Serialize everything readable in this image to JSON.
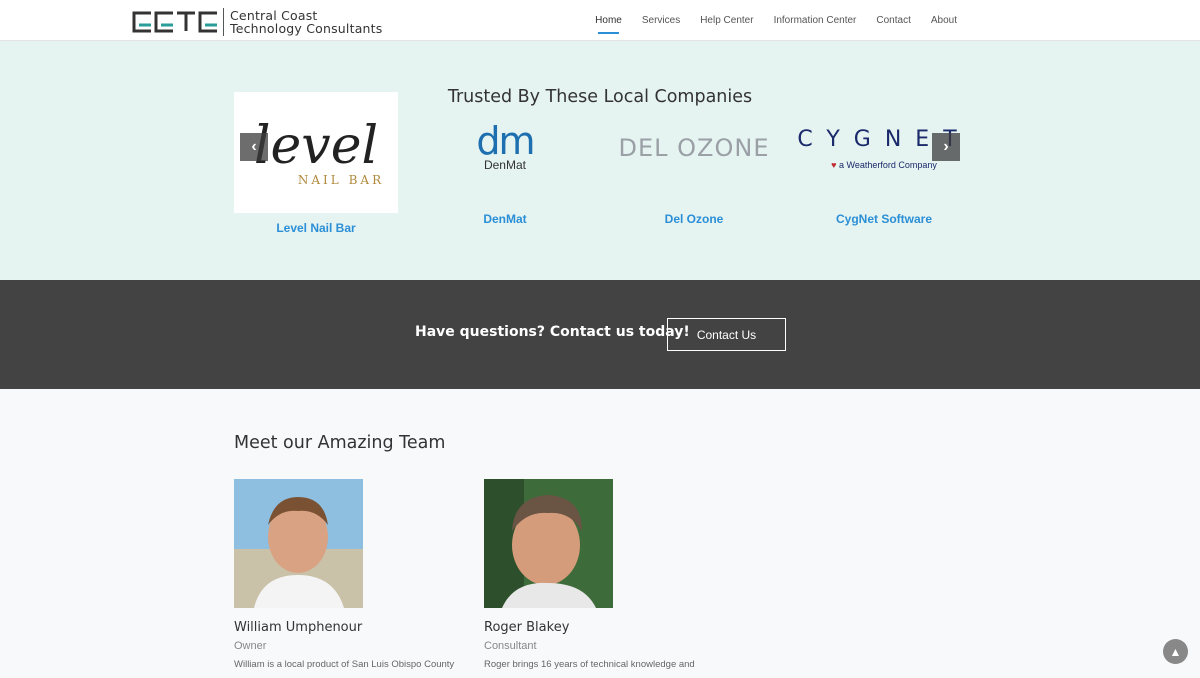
{
  "header": {
    "logo_lines": [
      "Central Coast",
      "Technology Consultants"
    ],
    "nav": [
      "Home",
      "Services",
      "Help Center",
      "Information Center",
      "Contact",
      "About"
    ]
  },
  "companies": {
    "title": "Trusted By These Local Companies",
    "items": [
      {
        "name": "Level Nail Bar",
        "logo_text": "level",
        "logo_sub": "NAIL BAR"
      },
      {
        "name": "DenMat",
        "logo_text": "dm",
        "logo_sub": "DenMat"
      },
      {
        "name": "Del Ozone",
        "logo_text": "DEL OZONE"
      },
      {
        "name": "CygNet Software",
        "logo_text": "CYGNET",
        "logo_sub": "a Weatherford Company"
      }
    ]
  },
  "cta": {
    "text": "Have questions? Contact us today!",
    "button": "Contact Us"
  },
  "team": {
    "title": "Meet our Amazing Team",
    "members": [
      {
        "name": "William Umphenour",
        "role": "Owner",
        "bio": "William is a local product of San Luis Obispo County"
      },
      {
        "name": "Roger Blakey",
        "role": "Consultant",
        "bio": "Roger brings 16 years of technical knowledge and"
      }
    ]
  },
  "colors": {
    "accent": "#2a8fd6",
    "teal": "#2a9d9a",
    "dark_band": "#434343",
    "companies_bg": "#e5f3f1"
  }
}
